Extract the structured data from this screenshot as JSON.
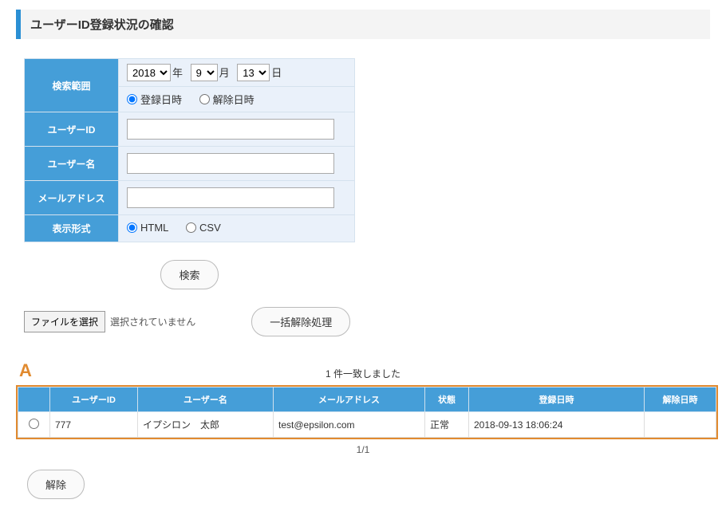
{
  "page_title": "ユーザーID登録状況の確認",
  "search": {
    "labels": {
      "range": "検索範囲",
      "user_id": "ユーザーID",
      "user_name": "ユーザー名",
      "email": "メールアドレス",
      "display": "表示形式"
    },
    "date": {
      "year": "2018",
      "year_unit": "年",
      "month": "9",
      "month_unit": "月",
      "day": "13",
      "day_unit": "日"
    },
    "date_scope": {
      "register": "登録日時",
      "release": "解除日時",
      "selected": "register"
    },
    "user_id_value": "",
    "user_name_value": "",
    "email_value": "",
    "display_format": {
      "html": "HTML",
      "csv": "CSV",
      "selected": "html"
    },
    "search_button": "検索"
  },
  "file_row": {
    "choose_button": "ファイルを選択",
    "no_file": "選択されていません",
    "bulk_release": "一括解除処理"
  },
  "annotation_letter": "A",
  "match_text": "1 件一致しました",
  "results": {
    "headers": {
      "user_id": "ユーザーID",
      "user_name": "ユーザー名",
      "email": "メールアドレス",
      "status": "状態",
      "reg_dt": "登録日時",
      "rel_dt": "解除日時"
    },
    "rows": [
      {
        "user_id": "777",
        "user_name": "イプシロン　太郎",
        "email": "test@epsilon.com",
        "status": "正常",
        "reg_dt": "2018-09-13 18:06:24",
        "rel_dt": ""
      }
    ]
  },
  "pager": "1/1",
  "release_button": "解除"
}
